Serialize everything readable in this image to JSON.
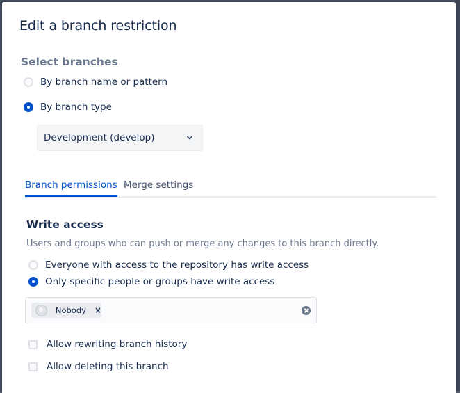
{
  "dialog": {
    "title": "Edit a branch restriction"
  },
  "select_branches": {
    "heading": "Select branches",
    "options": [
      {
        "label": "By branch name or pattern",
        "checked": false
      },
      {
        "label": "By branch type",
        "checked": true
      }
    ],
    "branch_type_value": "Development (develop)"
  },
  "tabs": [
    {
      "label": "Branch permissions",
      "active": true
    },
    {
      "label": "Merge settings",
      "active": false
    }
  ],
  "write_access": {
    "heading": "Write access",
    "description": "Users and groups who can push or merge any changes to this branch directly.",
    "options": [
      {
        "label": "Everyone with access to the repository has write access",
        "checked": false
      },
      {
        "label": "Only specific people or groups have write access",
        "checked": true
      }
    ],
    "selected_tag": "Nobody",
    "tag_remove": "×"
  },
  "checkboxes": [
    {
      "label": "Allow rewriting branch history",
      "checked": false
    },
    {
      "label": "Allow deleting this branch",
      "checked": false
    }
  ],
  "colors": {
    "accent": "#0052cc",
    "text": "#172b4d",
    "subtle": "#6b778c"
  }
}
